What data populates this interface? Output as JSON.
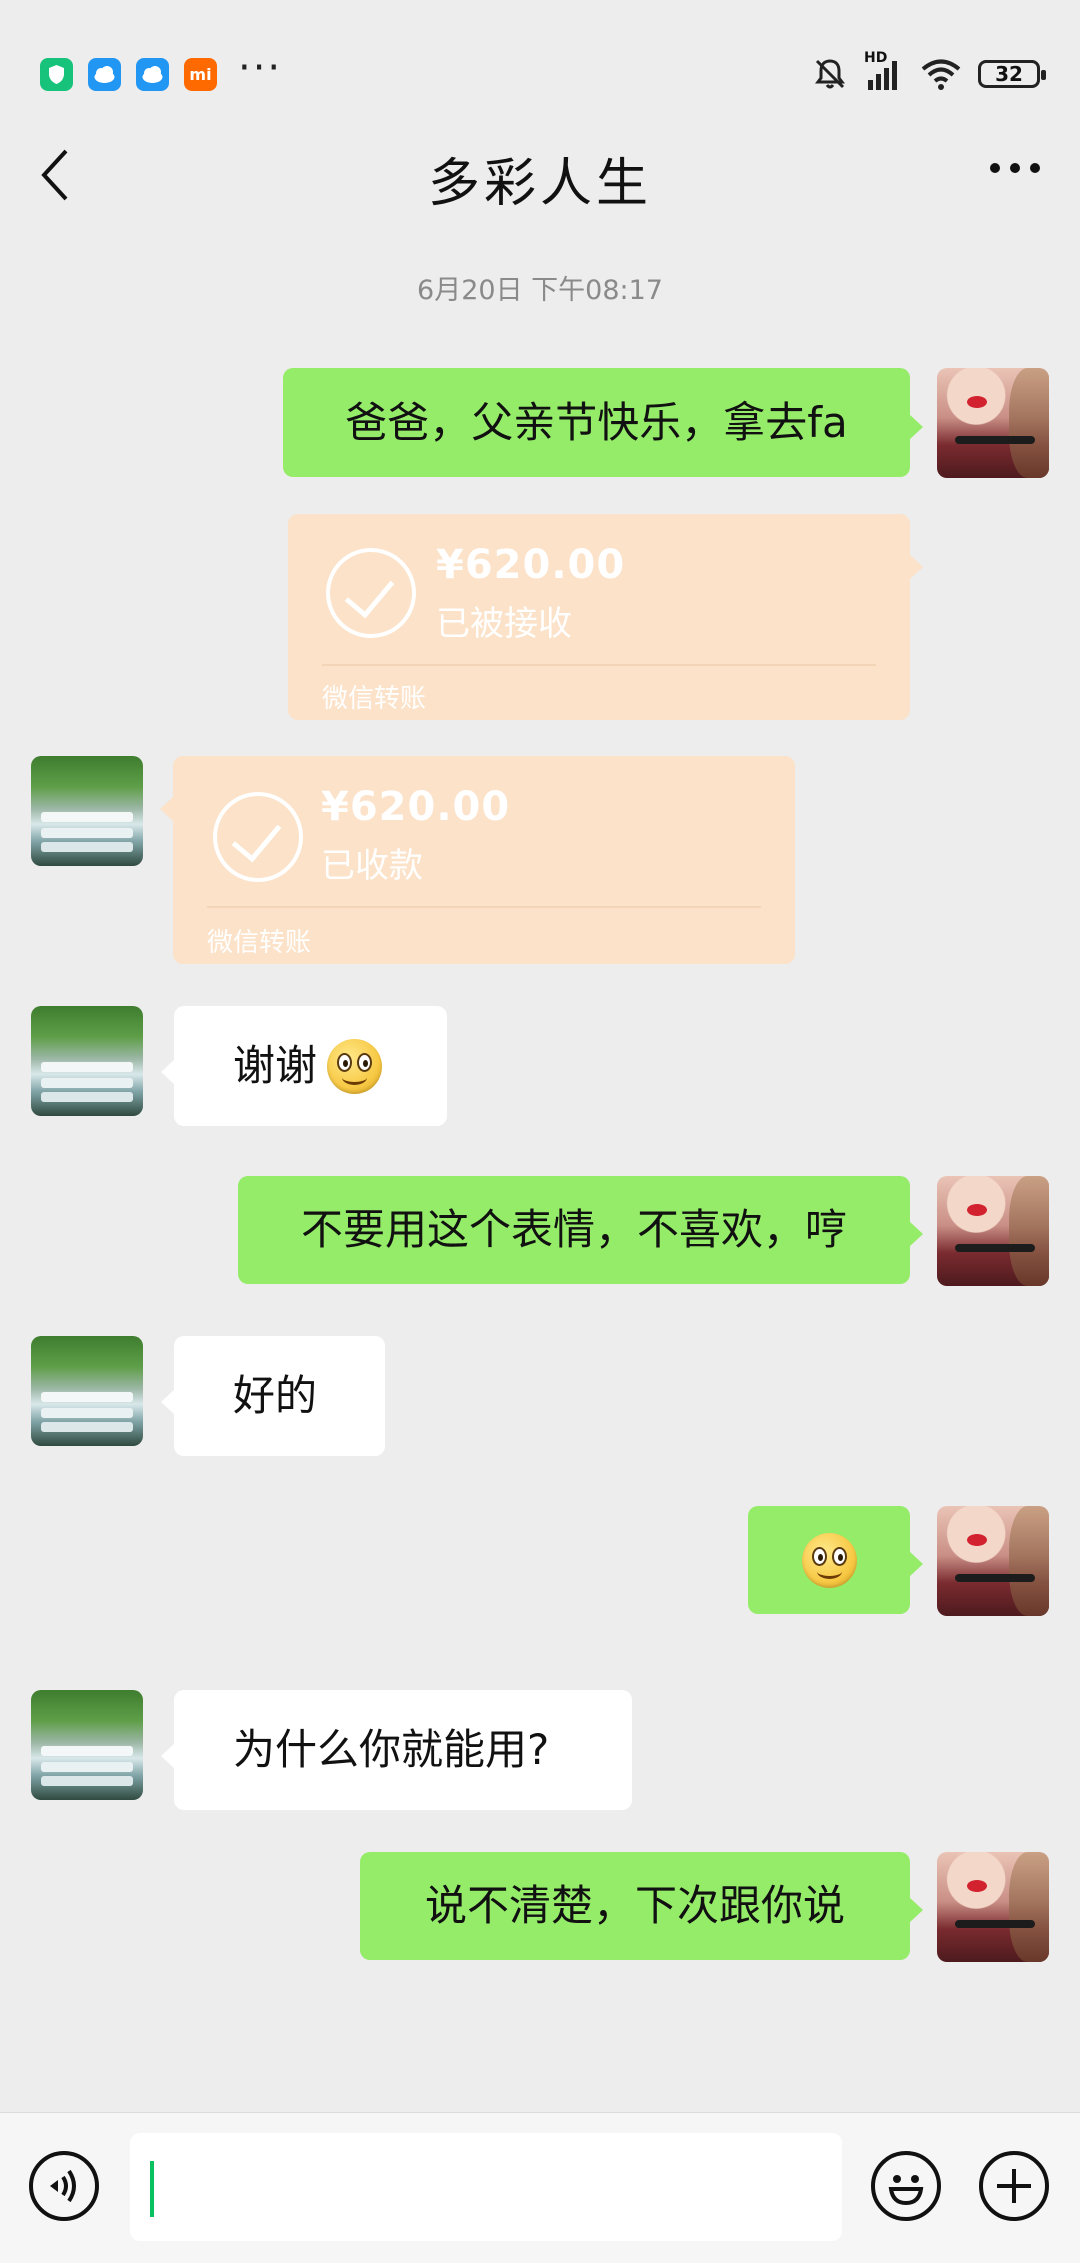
{
  "status_bar": {
    "left_icons": [
      "shield-app-icon",
      "cloud-app-icon",
      "cloud-app-icon",
      "mi-app-icon",
      "more-notifications-icon"
    ],
    "mi_label": "mi",
    "network_label": "HD",
    "battery": "32",
    "right_icons": [
      "mute-bell-icon",
      "signal-icon",
      "wifi-icon",
      "battery-icon"
    ]
  },
  "header": {
    "title": "多彩人生",
    "back_icon": "chevron-left-icon",
    "more_icon": "more-dots-icon"
  },
  "timestamp": "6月20日 下午08:17",
  "messages": [
    {
      "side": "me",
      "type": "text",
      "text": "爸爸，父亲节快乐，拿去fa"
    },
    {
      "side": "me",
      "type": "transfer",
      "amount": "¥620.00",
      "status": "已被接收",
      "footer": "微信转账"
    },
    {
      "side": "other",
      "type": "transfer",
      "amount": "¥620.00",
      "status": "已收款",
      "footer": "微信转账"
    },
    {
      "side": "other",
      "type": "text",
      "text": "谢谢",
      "emoji": "smile-emoji"
    },
    {
      "side": "me",
      "type": "text",
      "text": "不要用这个表情，不喜欢，哼"
    },
    {
      "side": "other",
      "type": "text",
      "text": "好的"
    },
    {
      "side": "me",
      "type": "emoji",
      "emoji": "smile-emoji"
    },
    {
      "side": "other",
      "type": "text",
      "text": "为什么你就能用?"
    },
    {
      "side": "me",
      "type": "text",
      "text": "说不清楚，下次跟你说"
    }
  ],
  "input_bar": {
    "voice_icon": "voice-icon",
    "input_value": "",
    "emoji_icon": "emoji-face-icon",
    "plus_icon": "plus-icon"
  },
  "colors": {
    "background": "#ededed",
    "my_bubble": "#95ec69",
    "other_bubble": "#ffffff",
    "transfer_card": "#fbe2c8",
    "caret": "#07c160"
  }
}
